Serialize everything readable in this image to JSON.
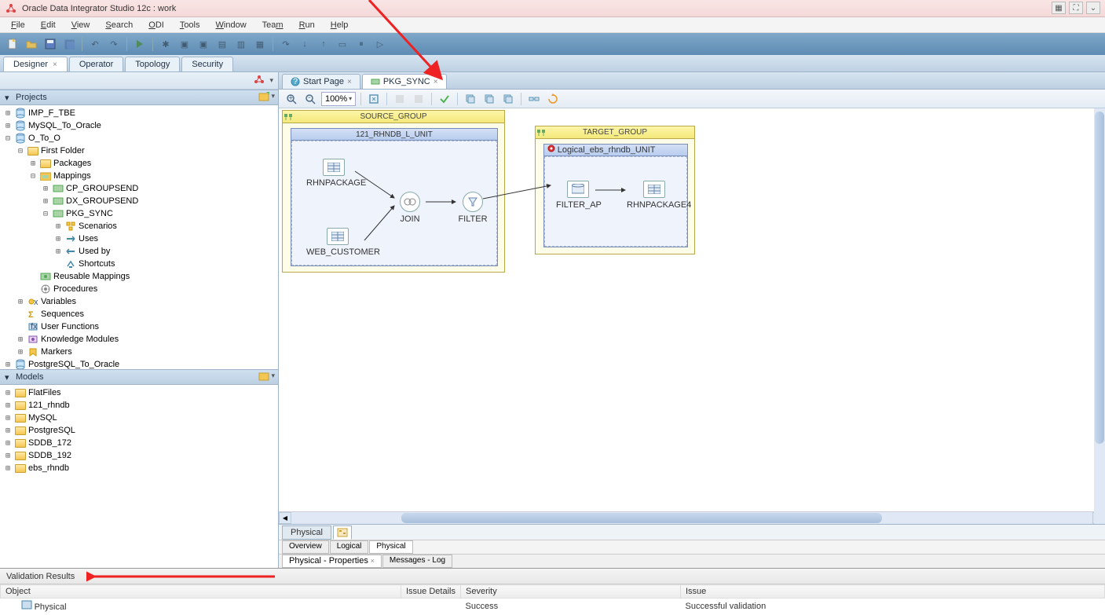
{
  "title": "Oracle Data Integrator Studio 12c : work",
  "menu": [
    "File",
    "Edit",
    "View",
    "Search",
    "ODI",
    "Tools",
    "Window",
    "Team",
    "Run",
    "Help"
  ],
  "perspectives": [
    {
      "label": "Designer",
      "active": true,
      "closable": true
    },
    {
      "label": "Operator",
      "active": false,
      "closable": false
    },
    {
      "label": "Topology",
      "active": false,
      "closable": false
    },
    {
      "label": "Security",
      "active": false,
      "closable": false
    }
  ],
  "projects_header": "Projects",
  "projects_tree": [
    {
      "d": 0,
      "exp": "+",
      "ico": "db",
      "label": "IMP_F_TBE"
    },
    {
      "d": 0,
      "exp": "+",
      "ico": "db",
      "label": "MySQL_To_Oracle"
    },
    {
      "d": 0,
      "exp": "-",
      "ico": "db",
      "label": "O_To_O"
    },
    {
      "d": 1,
      "exp": "-",
      "ico": "folder",
      "label": "First Folder"
    },
    {
      "d": 2,
      "exp": "+",
      "ico": "folder",
      "label": "Packages"
    },
    {
      "d": 2,
      "exp": "-",
      "ico": "folder-map",
      "label": "Mappings"
    },
    {
      "d": 3,
      "exp": "+",
      "ico": "map",
      "label": "CP_GROUPSEND"
    },
    {
      "d": 3,
      "exp": "+",
      "ico": "map",
      "label": "DX_GROUPSEND"
    },
    {
      "d": 3,
      "exp": "-",
      "ico": "map",
      "label": "PKG_SYNC"
    },
    {
      "d": 4,
      "exp": "+",
      "ico": "scen",
      "label": "Scenarios"
    },
    {
      "d": 4,
      "exp": "+",
      "ico": "uses",
      "label": "Uses"
    },
    {
      "d": 4,
      "exp": "+",
      "ico": "usedby",
      "label": "Used by"
    },
    {
      "d": 4,
      "exp": "",
      "ico": "short",
      "label": "Shortcuts"
    },
    {
      "d": 2,
      "exp": "",
      "ico": "rmap",
      "label": "Reusable Mappings"
    },
    {
      "d": 2,
      "exp": "",
      "ico": "proc",
      "label": "Procedures"
    },
    {
      "d": 1,
      "exp": "+",
      "ico": "var",
      "label": "Variables"
    },
    {
      "d": 1,
      "exp": "",
      "ico": "seq",
      "label": "Sequences"
    },
    {
      "d": 1,
      "exp": "",
      "ico": "func",
      "label": "User Functions"
    },
    {
      "d": 1,
      "exp": "+",
      "ico": "km",
      "label": "Knowledge Modules"
    },
    {
      "d": 1,
      "exp": "+",
      "ico": "mark",
      "label": "Markers"
    },
    {
      "d": 0,
      "exp": "+",
      "ico": "db",
      "label": "PostgreSQL_To_Oracle"
    }
  ],
  "models_header": "Models",
  "models_tree": [
    {
      "d": 0,
      "exp": "+",
      "ico": "folder",
      "label": "FlatFiles"
    },
    {
      "d": 0,
      "exp": "+",
      "ico": "folder",
      "label": "121_rhndb"
    },
    {
      "d": 0,
      "exp": "+",
      "ico": "folder",
      "label": "MySQL"
    },
    {
      "d": 0,
      "exp": "+",
      "ico": "folder",
      "label": "PostgreSQL"
    },
    {
      "d": 0,
      "exp": "+",
      "ico": "folder",
      "label": "SDDB_172"
    },
    {
      "d": 0,
      "exp": "+",
      "ico": "folder",
      "label": "SDDB_192"
    },
    {
      "d": 0,
      "exp": "+",
      "ico": "folder",
      "label": "ebs_rhndb"
    }
  ],
  "editor_tabs": [
    {
      "label": "Start Page",
      "active": false
    },
    {
      "label": "PKG_SYNC",
      "active": true
    }
  ],
  "zoom": "100%",
  "source_group": {
    "title": "SOURCE_GROUP",
    "unit": "121_RHNDB_L_UNIT",
    "nodes": {
      "rhnpackage": "RHNPACKAGE",
      "web_customer": "WEB_CUSTOMER",
      "join": "JOIN",
      "filter": "FILTER"
    }
  },
  "target_group": {
    "title": "TARGET_GROUP",
    "unit": "Logical_ebs_rhndb_UNIT",
    "nodes": {
      "filter_ap": "FILTER_AP",
      "rhnpackage4": "RHNPACKAGE4"
    }
  },
  "bottom_tabs": [
    "Physical"
  ],
  "sub_tabs": [
    "Overview",
    "Logical",
    "Physical"
  ],
  "sub_tab_active": "Physical",
  "prop_tabs": [
    "Physical - Properties",
    "Messages - Log"
  ],
  "validation": {
    "header": "Validation Results",
    "columns": [
      "Object",
      "Issue Details",
      "Severity",
      "Issue"
    ],
    "rows": [
      {
        "object": "Physical",
        "issue_details": "",
        "severity": "Success",
        "issue": "Successful validation"
      }
    ]
  }
}
